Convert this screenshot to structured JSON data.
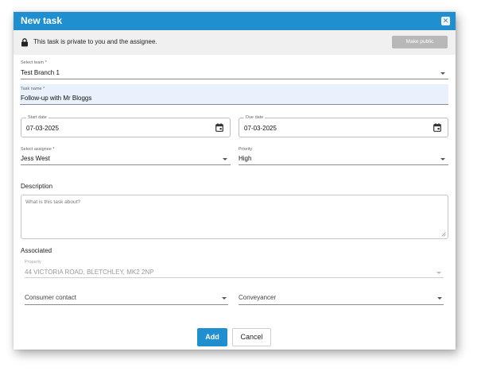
{
  "dialog": {
    "title": "New task"
  },
  "privacy": {
    "message": "This task is private to you and the assignee.",
    "make_public_label": "Make public"
  },
  "form": {
    "team": {
      "label": "Select team *",
      "value": "Test Branch 1"
    },
    "task_name": {
      "label": "Task name *",
      "value": "Follow-up with Mr Bloggs"
    },
    "start_date": {
      "label": "Start date",
      "value": "07-03-2025"
    },
    "due_date": {
      "label": "Due date",
      "value": "07-03-2025"
    },
    "assignee": {
      "label": "Select assignee *",
      "value": "Jess West"
    },
    "priority": {
      "label": "Priority",
      "value": "High"
    },
    "description": {
      "label": "Description",
      "placeholder": "What is this task about?"
    }
  },
  "associated": {
    "title": "Associated",
    "property": {
      "label": "Property",
      "value": "44 VICTORIA ROAD, BLETCHLEY, MK2 2NP"
    },
    "consumer_contact": {
      "label": "Consumer contact"
    },
    "conveyancer": {
      "label": "Conveyancer"
    }
  },
  "actions": {
    "add_label": "Add",
    "cancel_label": "Cancel"
  },
  "colors": {
    "accent": "#1f8fd0",
    "filled_background": "#e9f1fc",
    "disabled_button": "#b8b8b8"
  },
  "icons": {
    "lock": "lock-icon",
    "calendar": "calendar-icon",
    "close": "close-icon",
    "dropdown": "chevron-down-icon"
  }
}
